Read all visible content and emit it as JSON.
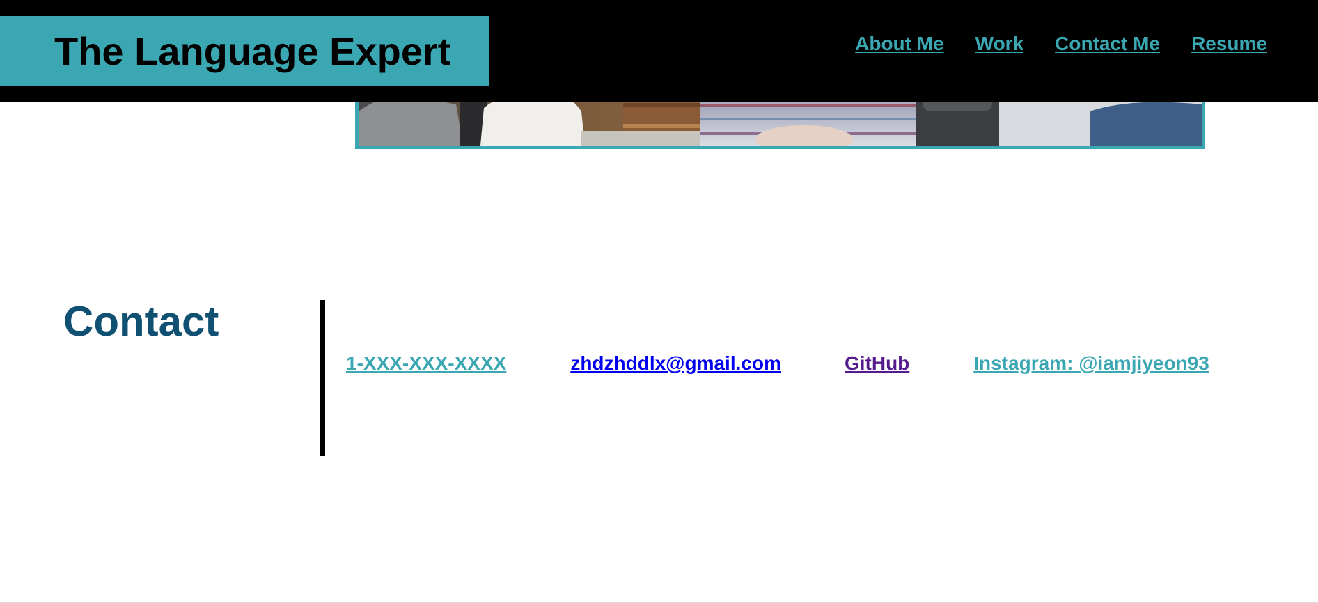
{
  "header": {
    "brand_title": "The Language Expert",
    "nav": [
      {
        "label": "About Me"
      },
      {
        "label": "Work"
      },
      {
        "label": "Contact Me"
      },
      {
        "label": "Resume"
      }
    ]
  },
  "contact": {
    "heading": "Contact",
    "phone": "1-XXX-XXX-XXXX",
    "email": "zhdzhddlx@gmail.com",
    "github": "GitHub",
    "instagram": "Instagram: @iamjiyeon93"
  },
  "colors": {
    "accent": "#3aa7b3",
    "header_bg": "#000000",
    "heading": "#0f5073",
    "link_default": "#0000ee",
    "link_visited": "#551a8b"
  }
}
